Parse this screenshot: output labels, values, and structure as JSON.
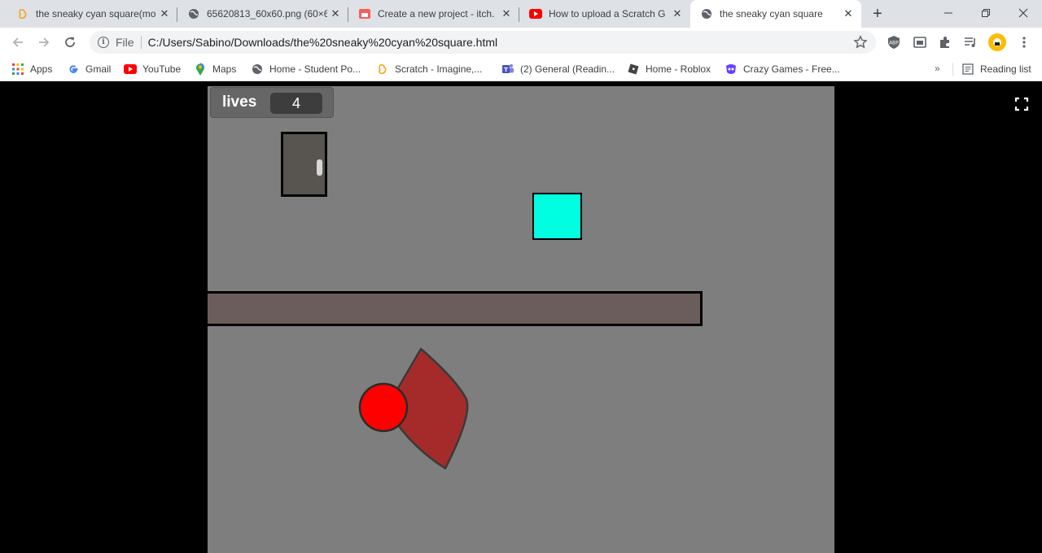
{
  "browser": {
    "tabs": [
      {
        "label": "the sneaky cyan square(mo",
        "icon": "scratch-icon",
        "active": false
      },
      {
        "label": "65620813_60x60.png (60×6",
        "icon": "globe-icon",
        "active": false
      },
      {
        "label": "Create a new project - itch.",
        "icon": "itch-icon",
        "active": false
      },
      {
        "label": "How to upload a Scratch G",
        "icon": "youtube-icon",
        "active": false
      },
      {
        "label": "the sneaky cyan square",
        "icon": "globe-icon",
        "active": true
      }
    ],
    "address": {
      "scheme_label": "File",
      "url": "C:/Users/Sabino/Downloads/the%20sneaky%20cyan%20square.html"
    },
    "bookmarks": [
      {
        "label": "Apps",
        "icon": "apps-grid-icon"
      },
      {
        "label": "Gmail",
        "icon": "google-icon"
      },
      {
        "label": "YouTube",
        "icon": "youtube-icon"
      },
      {
        "label": "Maps",
        "icon": "maps-icon"
      },
      {
        "label": "Home - Student Po...",
        "icon": "globe-icon"
      },
      {
        "label": "Scratch - Imagine,...",
        "icon": "scratch-icon"
      },
      {
        "label": "(2) General (Readin...",
        "icon": "teams-icon"
      },
      {
        "label": "Home - Roblox",
        "icon": "roblox-icon"
      },
      {
        "label": "Crazy Games - Free...",
        "icon": "crazygames-icon"
      }
    ],
    "bookmarks_more": "»",
    "reading_list": "Reading list"
  },
  "game": {
    "monitor_label": "lives",
    "monitor_value": "4"
  },
  "colors": {
    "stage_bg": "#7e7e7e",
    "player": "#00ffe0",
    "enemy_ball": "#ff0000",
    "enemy_cone": "#a52b2b",
    "platform": "#6b5d5b",
    "door": "#58544f"
  }
}
